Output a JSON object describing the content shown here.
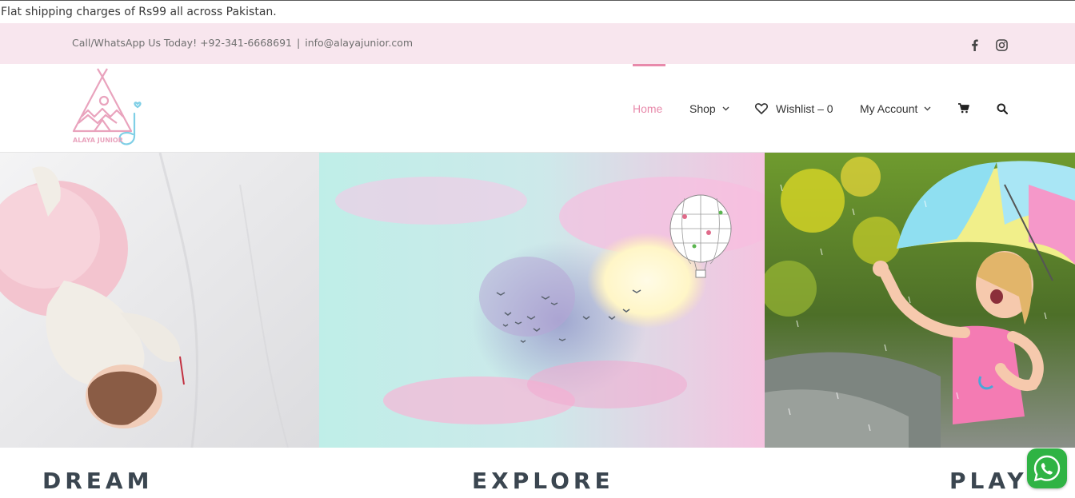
{
  "announcement": {
    "text": "Flat shipping charges of Rs99 all across Pakistan."
  },
  "contact": {
    "phone_text": "Call/WhatsApp Us Today! +92-341-6668691",
    "separator": "|",
    "email_text": "info@alayajunior.com"
  },
  "social": {
    "icons": [
      "facebook-icon",
      "instagram-icon"
    ]
  },
  "logo": {
    "text": "ALAYA JUNIOR"
  },
  "nav": {
    "home": "Home",
    "shop": "Shop",
    "wishlist": "Wishlist – 0",
    "account": "My Account",
    "icons": [
      "heart-icon",
      "cart-icon",
      "search-icon",
      "chevron-down-icon"
    ]
  },
  "captions": {
    "dream": "DREAM",
    "explore": "EXPLORE",
    "play": "PLAY"
  },
  "colors": {
    "accent": "#e88aab",
    "contact_bar": "#f8e6ee",
    "caption_text": "#3b4650",
    "whatsapp": "#2fb344"
  }
}
